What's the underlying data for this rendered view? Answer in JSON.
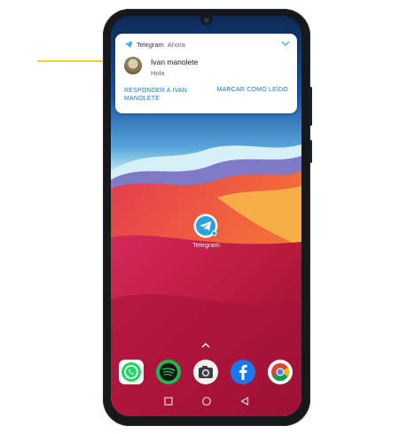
{
  "notification": {
    "app_name": "Telegram",
    "time": "Ahora",
    "sender": "Ivan manolete",
    "message": "Hola",
    "action_reply": "RESPONDER A IVAN MANOLETE",
    "action_mark_read": "MARCAR COMO LEÍDO",
    "avatar": "avatar-photo"
  },
  "home_screen": {
    "app_label": "Telegram",
    "app_icon": "telegram-icon"
  },
  "dock": [
    {
      "name": "whatsapp",
      "icon": "whatsapp-icon",
      "color": "#25d366"
    },
    {
      "name": "spotify",
      "icon": "spotify-icon",
      "color": "#1db954"
    },
    {
      "name": "camera",
      "icon": "camera-icon",
      "color": "#f2f2f2"
    },
    {
      "name": "facebook",
      "icon": "facebook-icon",
      "color": "#1877f2"
    },
    {
      "name": "chrome",
      "icon": "chrome-icon",
      "color": "#ffffff"
    }
  ],
  "navigation": [
    "square-icon",
    "circle-icon",
    "back-triangle-icon"
  ],
  "colors": {
    "annotation_arrow": "#f5d31c",
    "telegram_blue": "#2aa3dd",
    "action_blue": "#1a76c5",
    "phone_frame": "#16181c"
  }
}
